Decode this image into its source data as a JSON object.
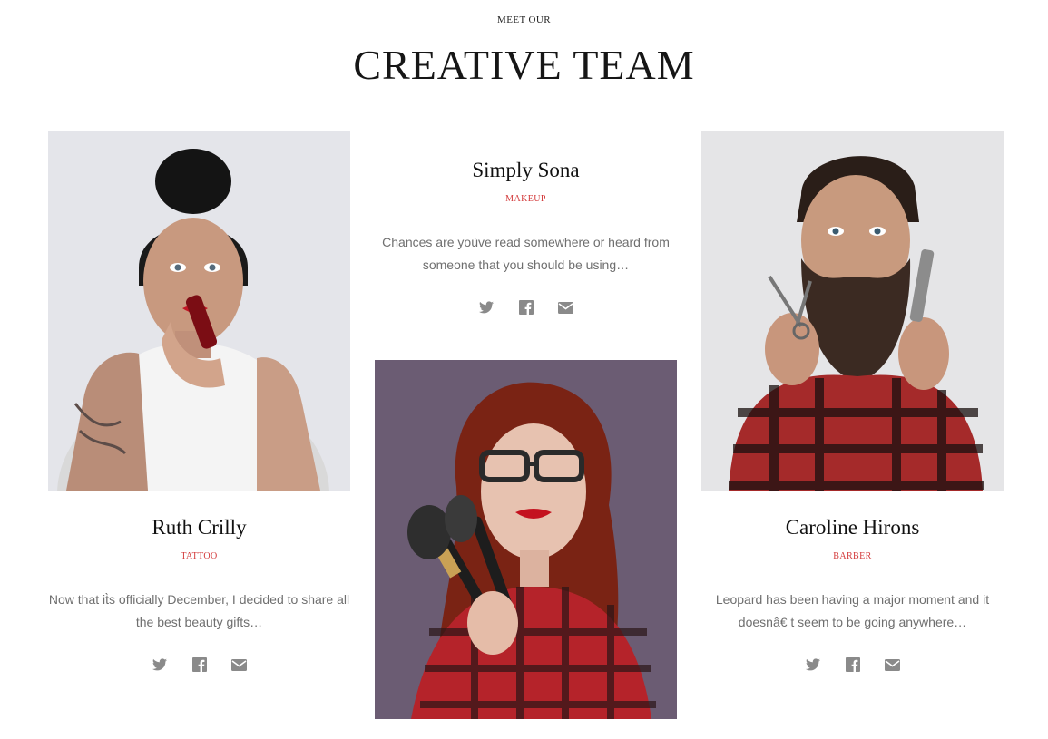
{
  "header": {
    "eyebrow": "MEET OUR",
    "title": "CREATIVE TEAM"
  },
  "members": [
    {
      "name": "Ruth Crilly",
      "role": "TATTOO",
      "bio": "Now that it̀s officially December, I decided to share all the best beauty gifts…"
    },
    {
      "name": "Simply Sona",
      "role": "MAKEUP",
      "bio": "Chances are yoùve read somewhere or heard from someone that you should be using…"
    },
    {
      "name": "Caroline Hirons",
      "role": "BARBER",
      "bio": "Leopard has been having a major moment and it doesnâ€ t seem to be going anywhere…"
    }
  ],
  "icons": [
    "twitter-icon",
    "facebook-icon",
    "envelope-icon"
  ],
  "colors": {
    "accent": "#d3393a",
    "text": "#161616",
    "muted": "#6f6f6f",
    "icon": "#8a8a8a"
  }
}
